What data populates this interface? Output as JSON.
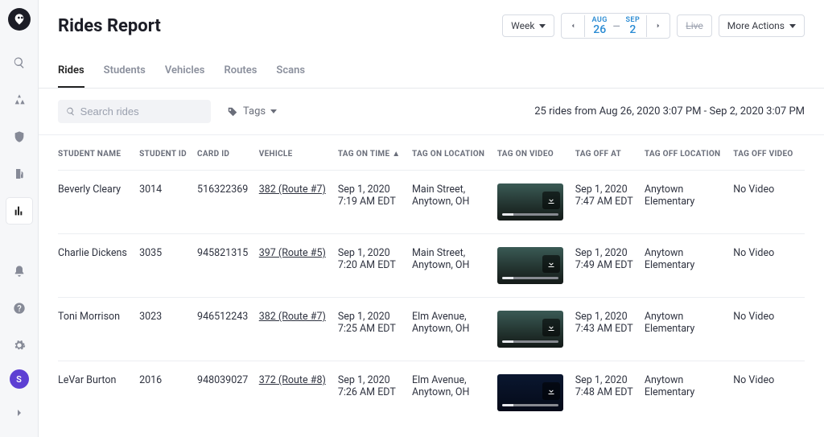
{
  "header": {
    "title": "Rides Report",
    "week_label": "Week",
    "date_start_month": "AUG",
    "date_start_day": "26",
    "date_end_month": "SEP",
    "date_end_day": "2",
    "live_label": "Live",
    "more_actions_label": "More Actions"
  },
  "tabs": {
    "rides": "Rides",
    "students": "Students",
    "vehicles": "Vehicles",
    "routes": "Routes",
    "scans": "Scans"
  },
  "filters": {
    "search_placeholder": "Search rides",
    "tags_label": "Tags",
    "summary": "25 rides from Aug 26, 2020 3:07 PM - Sep 2, 2020 3:07 PM"
  },
  "columns": {
    "student_name": "STUDENT NAME",
    "student_id": "STUDENT ID",
    "card_id": "CARD ID",
    "vehicle": "VEHICLE",
    "tag_on_time": "TAG ON TIME",
    "tag_on_location": "TAG ON LOCATION",
    "tag_on_video": "TAG ON VIDEO",
    "tag_off_at": "TAG OFF AT",
    "tag_off_location": "TAG OFF LOCATION",
    "tag_off_video": "TAG OFF VIDEO"
  },
  "rows": [
    {
      "student_name": "Beverly Cleary",
      "student_id": "3014",
      "card_id": "516322369",
      "vehicle": "382 (Route #7)",
      "tag_on_date": "Sep 1, 2020",
      "tag_on_time": "7:19 AM EDT",
      "tag_on_loc1": "Main Street,",
      "tag_on_loc2": "Anytown, OH",
      "tag_off_date": "Sep 1, 2020",
      "tag_off_time": "7:47 AM EDT",
      "tag_off_loc1": "Anytown",
      "tag_off_loc2": "Elementary",
      "tag_off_video": "No Video"
    },
    {
      "student_name": "Charlie Dickens",
      "student_id": "3035",
      "card_id": "945821315",
      "vehicle": "397 (Route #5)",
      "tag_on_date": "Sep 1, 2020",
      "tag_on_time": "7:20 AM EDT",
      "tag_on_loc1": "Main Street,",
      "tag_on_loc2": "Anytown, OH",
      "tag_off_date": "Sep 1, 2020",
      "tag_off_time": "7:49 AM EDT",
      "tag_off_loc1": "Anytown",
      "tag_off_loc2": "Elementary",
      "tag_off_video": "No Video"
    },
    {
      "student_name": "Toni Morrison",
      "student_id": "3023",
      "card_id": "946512243",
      "vehicle": "382 (Route #7)",
      "tag_on_date": "Sep 1, 2020",
      "tag_on_time": "7:25 AM EDT",
      "tag_on_loc1": "Elm Avenue,",
      "tag_on_loc2": "Anytown, OH",
      "tag_off_date": "Sep 1, 2020",
      "tag_off_time": "7:43 AM EDT",
      "tag_off_loc1": "Anytown",
      "tag_off_loc2": "Elementary",
      "tag_off_video": "No Video"
    },
    {
      "student_name": "LeVar Burton",
      "student_id": "2016",
      "card_id": "948039027",
      "vehicle": "372 (Route #8)",
      "tag_on_date": "Sep 1, 2020",
      "tag_on_time": "7:26 AM EDT",
      "tag_on_loc1": "Elm Avenue,",
      "tag_on_loc2": "Anytown, OH",
      "tag_off_date": "Sep 1, 2020",
      "tag_off_time": "7:48 AM EDT",
      "tag_off_loc1": "Anytown",
      "tag_off_loc2": "Elementary",
      "tag_off_video": "No Video"
    }
  ],
  "avatar_initial": "S"
}
